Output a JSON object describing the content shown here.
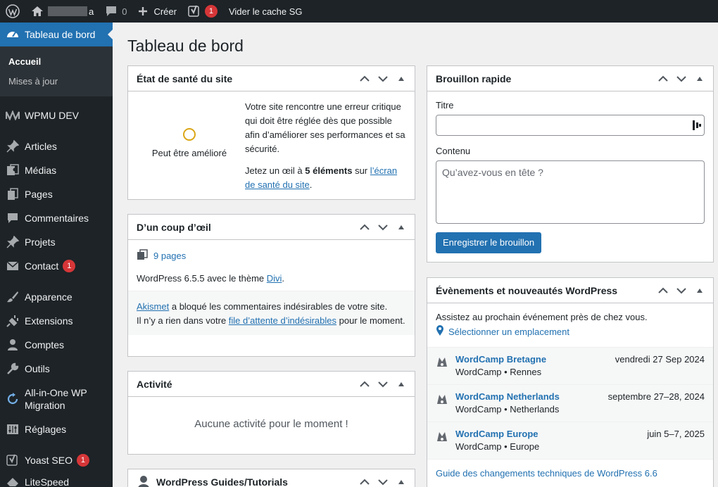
{
  "adminbar": {
    "site_suffix": "a",
    "comments_count": "0",
    "create_label": "Créer",
    "yoast_badge": "1",
    "cache_label": "Vider le cache SG"
  },
  "sidebar": {
    "dashboard": "Tableau de bord",
    "sub_home": "Accueil",
    "sub_updates": "Mises à jour",
    "wpmudev": "WPMU DEV",
    "articles": "Articles",
    "medias": "Médias",
    "pages": "Pages",
    "comments": "Commentaires",
    "projects": "Projets",
    "contact": "Contact",
    "contact_badge": "1",
    "appearance": "Apparence",
    "extensions": "Extensions",
    "accounts": "Comptes",
    "tools": "Outils",
    "aio_line1": "All-in-One WP",
    "aio_line2": "Migration",
    "settings": "Réglages",
    "yoast": "Yoast SEO",
    "yoast_badge": "1",
    "next_partial": "LiteSpeed"
  },
  "page": {
    "title": "Tableau de bord"
  },
  "health": {
    "title": "État de santé du site",
    "status": "Peut être amélioré",
    "message": "Votre site rencontre une erreur critique qui doit être réglée dès que possible afin d’améliorer ses performances et sa sécurité.",
    "look_prefix": "Jetez un œil à ",
    "look_count": "5 éléments",
    "look_mid": " sur ",
    "look_link": "l’écran de santé du site",
    "look_suffix": "."
  },
  "glance": {
    "title": "D’un coup d’œil",
    "pages": "9 pages",
    "version_prefix": "WordPress 6.5.5 avec le thème ",
    "theme": "Divi",
    "version_suffix": ".",
    "akismet_link": "Akismet",
    "akismet_text": " a bloqué les commentaires indésirables de votre site.",
    "queue_prefix": "Il n’y a rien dans votre ",
    "queue_link": "file d’attente d’indésirables",
    "queue_suffix": " pour le moment."
  },
  "activity": {
    "title": "Activité",
    "empty": "Aucune activité pour le moment !"
  },
  "guides": {
    "title": "WordPress Guides/Tutorials"
  },
  "draft": {
    "title": "Brouillon rapide",
    "title_label": "Titre",
    "content_label": "Contenu",
    "content_placeholder": "Qu’avez-vous en tête ?",
    "save_button": "Enregistrer le brouillon"
  },
  "events": {
    "title": "Évènements et nouveautés WordPress",
    "intro": "Assistez au prochain événement près de chez vous.",
    "select_location": "Sélectionner un emplacement",
    "items": [
      {
        "name": "WordCamp Bretagne",
        "meta": "WordCamp • Rennes",
        "date": "vendredi 27 Sep 2024"
      },
      {
        "name": "WordCamp Netherlands",
        "meta": "WordCamp • Netherlands",
        "date": "septembre 27–28, 2024"
      },
      {
        "name": "WordCamp Europe",
        "meta": "WordCamp • Europe",
        "date": "juin 5–7, 2025"
      }
    ],
    "footer_link": "Guide des changements techniques de WordPress 6.6"
  }
}
